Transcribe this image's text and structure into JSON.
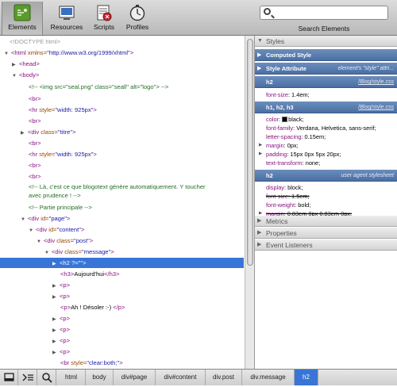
{
  "toolbar": {
    "tools": [
      {
        "label": "Elements",
        "icon": "elements-icon"
      },
      {
        "label": "Resources",
        "icon": "resources-icon"
      },
      {
        "label": "Scripts",
        "icon": "scripts-icon"
      },
      {
        "label": "Profiles",
        "icon": "profiles-icon"
      }
    ],
    "active_tool": "Elements",
    "search": {
      "value": "",
      "label": "Search Elements"
    }
  },
  "dom_tree": {
    "doctype": "<!DOCTYPE html>",
    "html_open": {
      "tag": "<html",
      "attr": " xmlns=",
      "val": "\"http://www.w3.org/1999/xhtml\"",
      "close": ">"
    },
    "head": "<head>",
    "body": "<body>",
    "comment_img": "<!-- <img src=\"seal.png\" class=\"seall\" alt=\"logo\"> -->",
    "br": "<br>",
    "hr_open": "<hr",
    "hr_attr": " style=",
    "hr_val": "\"width: 925px\"",
    "tag_close": ">",
    "div_open": "<div",
    "class_attr": " class=",
    "id_attr": " id=",
    "titre_val": "\"titre\"",
    "comment_la_1": "<!-- Là, c'est ce que blogotext génère automatiquement. Y toucher",
    "comment_la_2": "avec prudence ! -->",
    "comment_partie": "<!-- Partie principale -->",
    "page_val": "\"page\"",
    "content_val": "\"content\"",
    "post_val": "\"post\"",
    "message_val": "\"message\"",
    "h2_open": "<h2",
    "h2_attr": " ?=",
    "h2_val": "\"\"",
    "h3_open": "<h3>",
    "h3_text": "Aujourd'hui",
    "h3_close": "</h3>",
    "p_tag": "<p>",
    "p_open": "<p>",
    "p_text": "Ah ! Désoler :-) ",
    "p_close": "</p>",
    "br_open": "<br",
    "br_style_val": "\"clear:both;\""
  },
  "styles": {
    "section_title": "Styles",
    "computed": "Computed Style",
    "style_attribute": {
      "title": "Style Attribute",
      "note": "element's \"style\" attri..."
    },
    "rule1": {
      "selector": "h2",
      "source": "/Blog/style.css",
      "props": [
        {
          "name": "font-size",
          "value": "1.4em;"
        }
      ]
    },
    "rule2": {
      "selector": "h1, h2, h3",
      "source": "/Blog/style.css",
      "props": [
        {
          "name": "color",
          "value": "black;",
          "swatch": "#000000"
        },
        {
          "name": "font-family",
          "value": "Verdana, Helvetica, sans-serif;"
        },
        {
          "name": "letter-spacing",
          "value": "0.15em;"
        },
        {
          "name": "margin",
          "value": "0px;"
        },
        {
          "name": "padding",
          "value": "15px 0px 5px 20px;"
        },
        {
          "name": "text-transform",
          "value": "none;"
        }
      ]
    },
    "rule3": {
      "selector": "h2",
      "source": "user agent stylesheet",
      "props": [
        {
          "name": "display",
          "value": "block;"
        },
        {
          "name": "font-size",
          "value": "1.5em;"
        },
        {
          "name": "font-weight",
          "value": "bold;"
        },
        {
          "name": "margin",
          "value": "0.83em 0px 0.83em 0px;"
        }
      ]
    },
    "metrics": "Metrics",
    "properties": "Properties",
    "listeners": "Event Listeners"
  },
  "statusbar": {
    "breadcrumbs": [
      "html",
      "body",
      "div#page",
      "div#content",
      "div.post",
      "div.message",
      "h2"
    ],
    "active_crumb": "h2"
  },
  "colors": {
    "selection": "#3875d7",
    "tag": "#881280",
    "attr": "#994500",
    "value": "#1a1aa6",
    "comment": "#236e25"
  }
}
